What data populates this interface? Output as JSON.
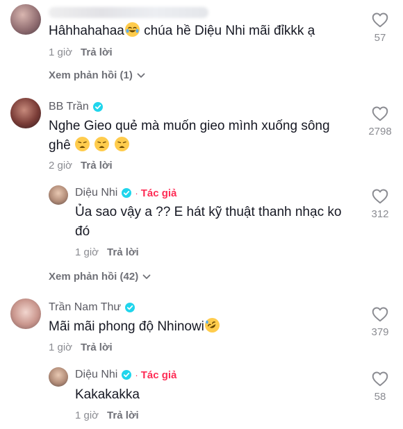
{
  "comments": [
    {
      "name": "",
      "verified": false,
      "text": "Hâhhahahaa",
      "text_after_emoji": " chúa hề Diệu Nhi mãi đỉkkk ạ",
      "emojis": [
        "face-with-tears-of-joy"
      ],
      "time": "1 giờ",
      "reply_label": "Trả lời",
      "likes": "57"
    },
    {
      "view_replies": "Xem phản hồi (1)"
    },
    {
      "name": "BB Trần",
      "verified": true,
      "text": "Nghe Gieo quẻ mà muốn gieo mình xuống sông ghê",
      "emojis": [
        "weary-face",
        "weary-face",
        "weary-face"
      ],
      "time": "2 giờ",
      "reply_label": "Trả lời",
      "likes": "2798",
      "reply": {
        "name": "Diệu Nhi",
        "verified": true,
        "author_badge": "Tác giả",
        "dot": "·",
        "text": "Ủa sao vậy a ?? E hát kỹ thuật thanh nhạc ko đó",
        "time": "1 giờ",
        "reply_label": "Trả lời",
        "likes": "312"
      },
      "view_replies": "Xem phản hồi (42)"
    },
    {
      "name": "Trần Nam Thư",
      "verified": true,
      "text": "Mãi mãi phong độ Nhinowi",
      "emojis": [
        "rolling-on-the-floor-laughing"
      ],
      "time": "1 giờ",
      "reply_label": "Trả lời",
      "likes": "379",
      "reply": {
        "name": "Diệu Nhi",
        "verified": true,
        "author_badge": "Tác giả",
        "dot": "·",
        "text": "Kakakakka",
        "time": "1 giờ",
        "reply_label": "Trả lời",
        "likes": "58"
      }
    }
  ],
  "colors": {
    "accent": "#fe2c55",
    "verified": "#20d5ec",
    "muted": "#8a8b91",
    "text": "#161823"
  }
}
